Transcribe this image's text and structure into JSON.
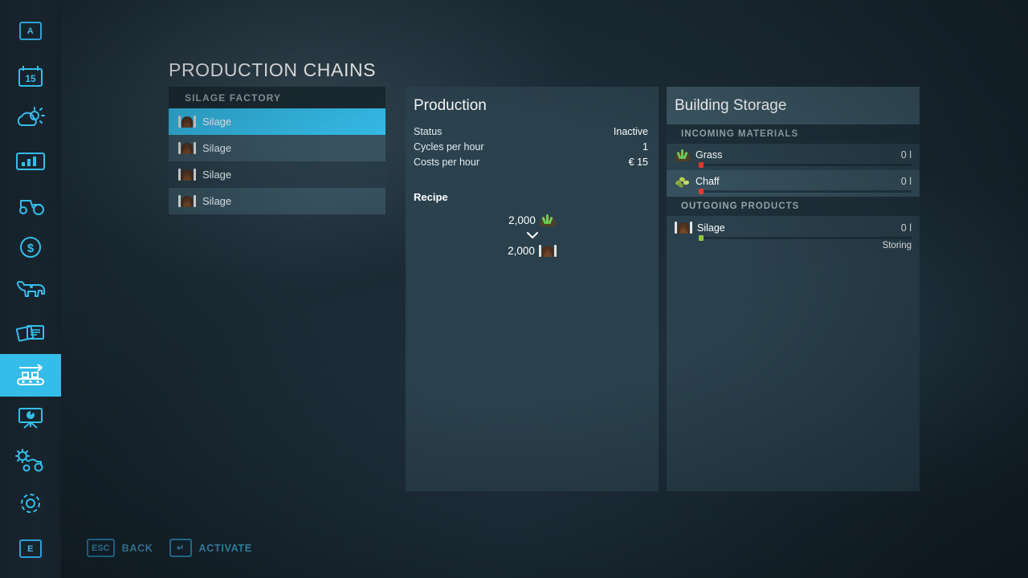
{
  "sidebar": {
    "items": [
      {
        "name": "key-a",
        "icon": "key-a-icon",
        "label": "A",
        "selected": false
      },
      {
        "name": "calendar",
        "icon": "calendar-icon",
        "label": "15",
        "selected": false
      },
      {
        "name": "weather",
        "icon": "weather-icon",
        "label": "",
        "selected": false
      },
      {
        "name": "statistics",
        "icon": "bar-chart-icon",
        "label": "",
        "selected": false
      },
      {
        "name": "vehicles",
        "icon": "tractor-icon",
        "label": "",
        "selected": false
      },
      {
        "name": "finances",
        "icon": "dollar-circle-icon",
        "label": "",
        "selected": false
      },
      {
        "name": "animals",
        "icon": "cow-icon",
        "label": "",
        "selected": false
      },
      {
        "name": "contracts",
        "icon": "documents-icon",
        "label": "",
        "selected": false
      },
      {
        "name": "production",
        "icon": "conveyor-belt-icon",
        "label": "",
        "selected": true
      },
      {
        "name": "info-board",
        "icon": "presentation-icon",
        "label": "",
        "selected": false
      },
      {
        "name": "vehicle-settings",
        "icon": "gear-tractor-icon",
        "label": "",
        "selected": false
      },
      {
        "name": "settings",
        "icon": "gear-icon",
        "label": "",
        "selected": false
      },
      {
        "name": "key-e",
        "icon": "key-e-icon",
        "label": "E",
        "selected": false
      }
    ]
  },
  "page": {
    "title": "PRODUCTION CHAINS"
  },
  "production_list": {
    "header": "SILAGE FACTORY",
    "rows": [
      {
        "label": "Silage",
        "icon": "silage-icon",
        "selected": true
      },
      {
        "label": "Silage",
        "icon": "silage-icon",
        "selected": false
      },
      {
        "label": "Silage",
        "icon": "silage-icon",
        "selected": false
      },
      {
        "label": "Silage",
        "icon": "silage-icon",
        "selected": false
      }
    ]
  },
  "production": {
    "title": "Production",
    "stats": [
      {
        "label": "Status",
        "value": "Inactive"
      },
      {
        "label": "Cycles per hour",
        "value": "1"
      },
      {
        "label": "Costs per hour",
        "value": "€ 15"
      }
    ],
    "recipe_title": "Recipe",
    "recipe": {
      "input": {
        "amount": "2,000",
        "icon": "grass-icon",
        "name": "Grass"
      },
      "arrow": "chevron-down-icon",
      "output": {
        "amount": "2,000",
        "icon": "silage-icon",
        "name": "Silage"
      }
    }
  },
  "storage": {
    "title": "Building Storage",
    "sections": [
      {
        "header": "INCOMING MATERIALS",
        "rows": [
          {
            "name": "Grass",
            "icon": "grass-icon",
            "amount": "0 l",
            "fill": 0,
            "marker_color": "#e23b30",
            "status": ""
          },
          {
            "name": "Chaff",
            "icon": "chaff-icon",
            "amount": "0 l",
            "fill": 0,
            "marker_color": "#e23b30",
            "status": ""
          }
        ]
      },
      {
        "header": "OUTGOING PRODUCTS",
        "rows": [
          {
            "name": "Silage",
            "icon": "silage-icon",
            "amount": "0 l",
            "fill": 0,
            "marker_color": "#8ec63f",
            "status": "Storing"
          }
        ]
      }
    ]
  },
  "footer": {
    "actions": [
      {
        "key": "ESC",
        "label": "BACK"
      },
      {
        "key": "↵",
        "label": "ACTIVATE"
      }
    ]
  },
  "colors": {
    "accent": "#35bdea",
    "panel": "#2c4450",
    "key_blue": "#47b6e4",
    "marker_red": "#e23b30",
    "marker_green": "#8ec63f"
  }
}
